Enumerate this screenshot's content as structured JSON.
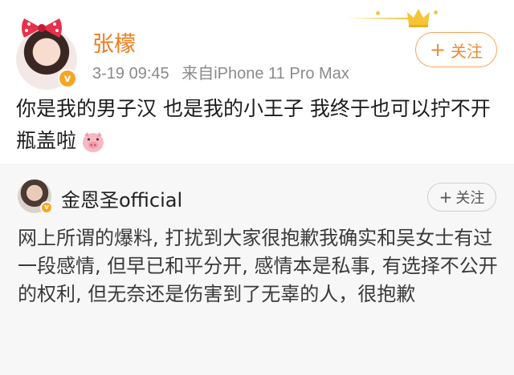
{
  "post": {
    "author": "张檬",
    "timestamp": "3-19 09:45",
    "source": "来自iPhone 11 Pro Max",
    "follow_label": "关注",
    "text": "你是我的男子汉  也是我的小王子  我终于也可以拧不开瓶盖啦",
    "emoji": "pig-face",
    "verified_badge": "v"
  },
  "repost": {
    "author": "金恩圣official",
    "follow_label": "关注",
    "text": "网上所谓的爆料, 打扰到大家很抱歉我确实和吴女士有过一段感情, 但早已和平分开, 感情本是私事, 有选择不公开的权利, 但无奈还是伤害到了无辜的人，很抱歉",
    "verified_badge": "v"
  },
  "colors": {
    "author_name": "#f07b1d",
    "follow_border": "#f0a55c",
    "verified": "#f5a623",
    "repost_background": "#f7f7f7"
  }
}
